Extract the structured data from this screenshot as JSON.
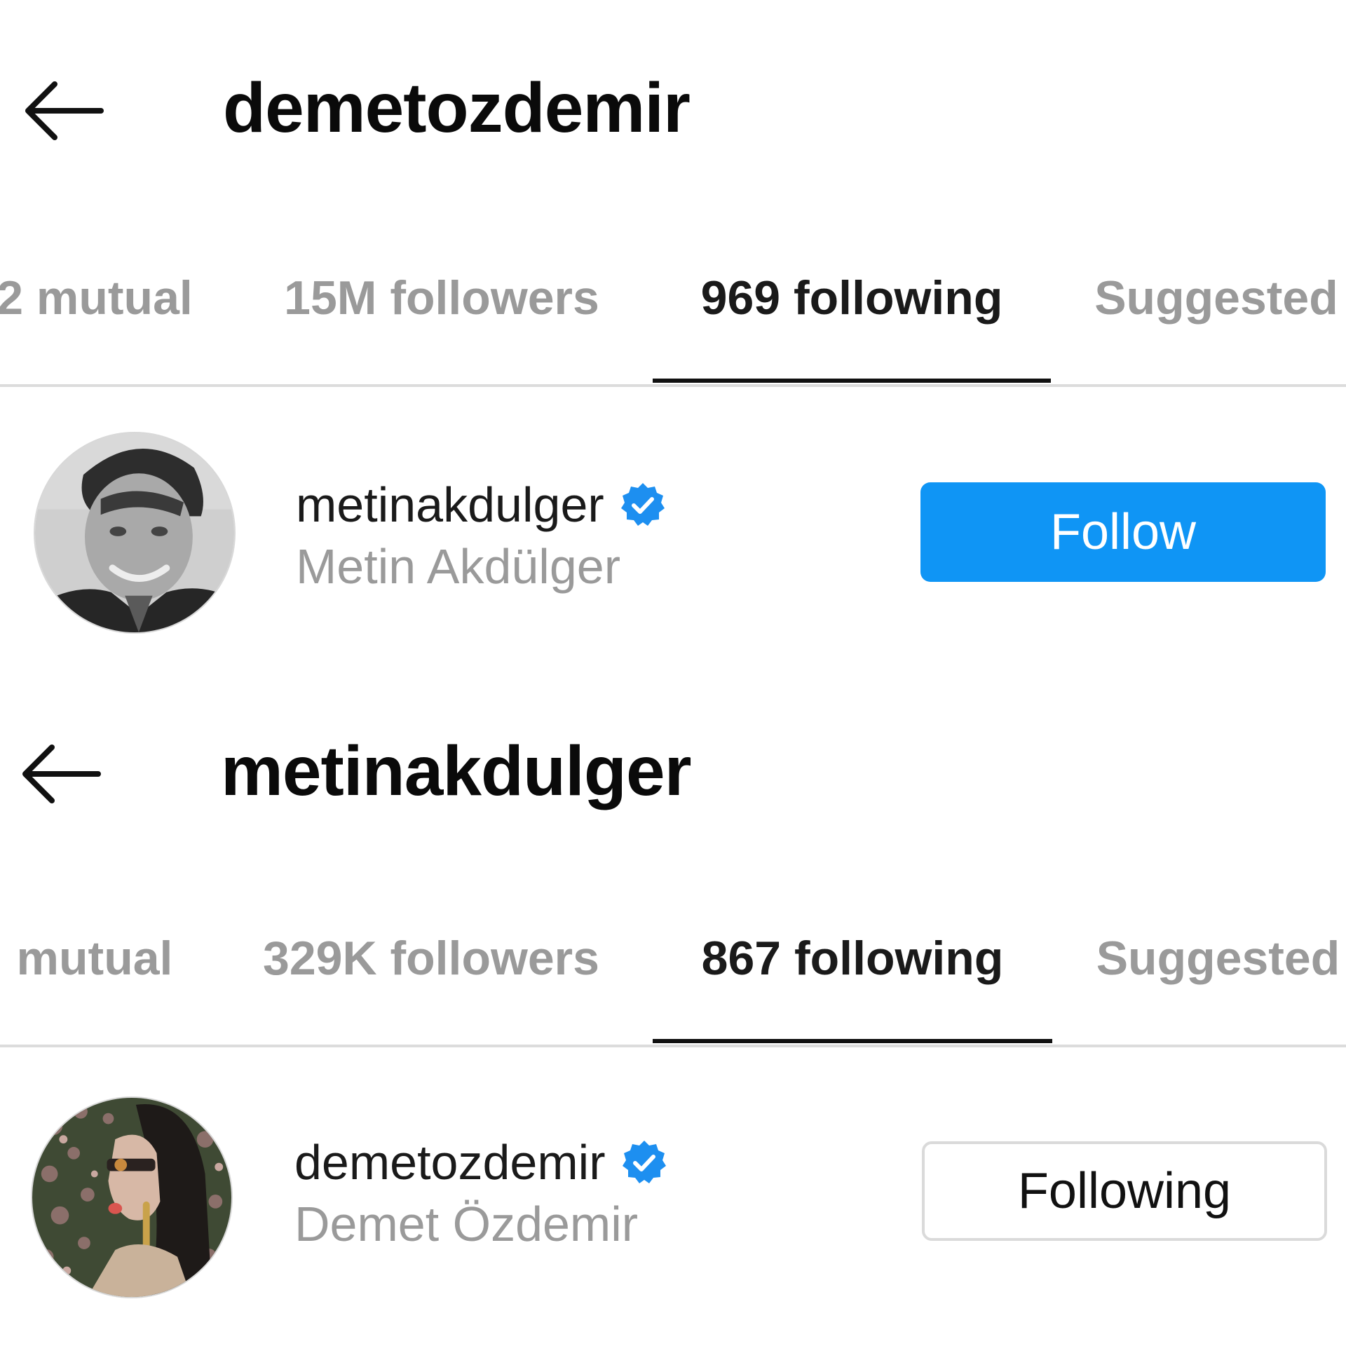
{
  "colors": {
    "accent_blue": "#0f95f5",
    "inactive_tab_text": "#9a9a9a",
    "divider": "#dcdcdc"
  },
  "panel_1": {
    "header": {
      "back_icon": "arrow-left-icon",
      "title": "demetozdemir"
    },
    "tabs": [
      {
        "label": "2 mutual",
        "active": false
      },
      {
        "label": "15M followers",
        "active": false
      },
      {
        "label": "969 following",
        "active": true
      },
      {
        "label": "Suggested",
        "active": false
      }
    ],
    "user": {
      "username": "metinakdulger",
      "verified_icon": "verified-badge-icon",
      "full_name": "Metin Akdülger",
      "button_label": "Follow"
    }
  },
  "panel_2": {
    "header": {
      "back_icon": "arrow-left-icon",
      "title": "metinakdulger"
    },
    "tabs": [
      {
        "label": "mutual",
        "active": false
      },
      {
        "label": "329K followers",
        "active": false
      },
      {
        "label": "867 following",
        "active": true
      },
      {
        "label": "Suggested",
        "active": false
      }
    ],
    "user": {
      "username": "demetozdemir",
      "verified_icon": "verified-badge-icon",
      "full_name": "Demet Özdemir",
      "button_label": "Following"
    }
  }
}
